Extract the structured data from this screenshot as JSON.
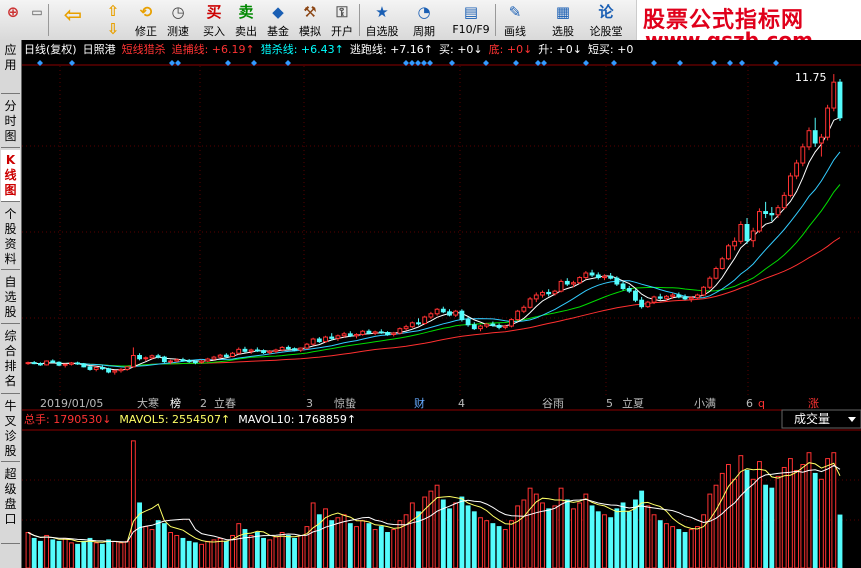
{
  "toolbar": {
    "buttons": [
      {
        "label": "修正",
        "icon": "⟲",
        "name": "revise-button"
      },
      {
        "label": "测速",
        "icon": "◷",
        "name": "speedtest-button"
      },
      {
        "label": "买入",
        "icon": "买",
        "name": "buy-button"
      },
      {
        "label": "卖出",
        "icon": "卖",
        "name": "sell-button"
      },
      {
        "label": "基金",
        "icon": "◆",
        "name": "fund-button"
      },
      {
        "label": "模拟",
        "icon": "⚒",
        "name": "simulate-button"
      },
      {
        "label": "开户",
        "icon": "⚿",
        "name": "open-account-button"
      },
      {
        "label": "自选股",
        "icon": "★",
        "name": "watchlist-button"
      },
      {
        "label": "周期",
        "icon": "◔",
        "name": "period-button"
      },
      {
        "label": "F10/F9",
        "icon": "▤",
        "name": "f10-button"
      },
      {
        "label": "画线",
        "icon": "✎",
        "name": "draw-line-button"
      },
      {
        "label": "选股",
        "icon": "▦",
        "name": "stock-pick-button"
      },
      {
        "label": "论股堂",
        "icon": "论",
        "name": "forum-button"
      }
    ]
  },
  "watermark": {
    "line1": "股票公式指标网",
    "line2": "www.gszb.com"
  },
  "sidebar": {
    "tabs": [
      {
        "label": "应用",
        "active": false
      },
      {
        "label": "分时图",
        "active": false
      },
      {
        "label": "K线图",
        "active": true
      },
      {
        "label": "个股资料",
        "active": false
      },
      {
        "label": "自选股",
        "active": false
      },
      {
        "label": "综合排名",
        "active": false
      },
      {
        "label": "牛叉诊股",
        "active": false
      },
      {
        "label": "超级盘口",
        "active": false
      }
    ]
  },
  "indicator_bar": {
    "items": [
      {
        "text": "日线(复权)",
        "color": "#ffffff"
      },
      {
        "text": "日照港",
        "color": "#ffffff"
      },
      {
        "text": "短线猎杀",
        "color": "#ff3333"
      },
      {
        "text": "追捕线: +6.19↑",
        "color": "#ff3333"
      },
      {
        "text": "猎杀线: +6.43↑",
        "color": "#00ffff"
      },
      {
        "text": "逃跑线: +7.16↑",
        "color": "#ffffff"
      },
      {
        "text": "买: +0↓",
        "color": "#ffffff"
      },
      {
        "text": "底: +0↓",
        "color": "#ff3333"
      },
      {
        "text": "升: +0↓",
        "color": "#ffffff"
      },
      {
        "text": "短买: +0",
        "color": "#ffffff"
      }
    ]
  },
  "price_label": "11.75",
  "axis_labels": [
    {
      "text": "2019/01/05",
      "color": "#bbbbbb"
    },
    {
      "text": "大寒",
      "color": "#bbbbbb"
    },
    {
      "text": "榜",
      "color": "#ffffff"
    },
    {
      "text": "2",
      "color": "#bbbbbb"
    },
    {
      "text": "立春",
      "color": "#bbbbbb"
    },
    {
      "text": "3",
      "color": "#bbbbbb"
    },
    {
      "text": "惊蛰",
      "color": "#bbbbbb"
    },
    {
      "text": "财",
      "color": "#66aaff"
    },
    {
      "text": "4",
      "color": "#bbbbbb"
    },
    {
      "text": "谷雨",
      "color": "#bbbbbb"
    },
    {
      "text": "5",
      "color": "#bbbbbb"
    },
    {
      "text": "立夏",
      "color": "#bbbbbb"
    },
    {
      "text": "小满",
      "color": "#bbbbbb"
    },
    {
      "text": "6",
      "color": "#bbbbbb"
    },
    {
      "text": "q",
      "color": "#ff3333"
    },
    {
      "text": "涨",
      "color": "#ff3333"
    }
  ],
  "volume_bar": {
    "total": "总手: 1790530↓",
    "ma5": "MAVOL5: 2554507↑",
    "ma10": "MAVOL10: 1768859↑",
    "dropdown": "成交量",
    "colors": {
      "total": "#ff3333",
      "ma5": "#ffff66",
      "ma10": "#ffffff"
    }
  },
  "chart_data": {
    "type": "candlestick",
    "symbol": "日照港",
    "period": "日线(复权)",
    "price_ylim": [
      2.2,
      12.0
    ],
    "latest_price_label": 11.75,
    "candles": [
      [
        2.8,
        2.86,
        2.76,
        2.83
      ],
      [
        2.83,
        2.88,
        2.78,
        2.8
      ],
      [
        2.8,
        2.84,
        2.73,
        2.76
      ],
      [
        2.76,
        2.9,
        2.74,
        2.88
      ],
      [
        2.88,
        2.93,
        2.82,
        2.84
      ],
      [
        2.84,
        2.87,
        2.72,
        2.75
      ],
      [
        2.75,
        2.8,
        2.68,
        2.78
      ],
      [
        2.78,
        2.85,
        2.74,
        2.82
      ],
      [
        2.82,
        2.86,
        2.76,
        2.79
      ],
      [
        2.79,
        2.82,
        2.68,
        2.7
      ],
      [
        2.7,
        2.74,
        2.58,
        2.62
      ],
      [
        2.62,
        2.7,
        2.56,
        2.68
      ],
      [
        2.68,
        2.74,
        2.6,
        2.64
      ],
      [
        2.64,
        2.67,
        2.5,
        2.54
      ],
      [
        2.54,
        2.6,
        2.46,
        2.58
      ],
      [
        2.58,
        2.66,
        2.52,
        2.62
      ],
      [
        2.62,
        2.72,
        2.58,
        2.7
      ],
      [
        2.7,
        3.3,
        2.68,
        3.05
      ],
      [
        3.05,
        3.12,
        2.9,
        2.95
      ],
      [
        2.95,
        3.02,
        2.88,
        2.98
      ],
      [
        2.98,
        3.08,
        2.94,
        3.04
      ],
      [
        3.04,
        3.1,
        2.96,
        3.0
      ],
      [
        3.0,
        3.04,
        2.82,
        2.86
      ],
      [
        2.86,
        2.92,
        2.78,
        2.88
      ],
      [
        2.88,
        2.96,
        2.84,
        2.92
      ],
      [
        2.92,
        2.98,
        2.86,
        2.9
      ],
      [
        2.9,
        2.94,
        2.82,
        2.86
      ],
      [
        2.86,
        2.9,
        2.78,
        2.84
      ],
      [
        2.84,
        2.92,
        2.8,
        2.88
      ],
      [
        2.88,
        2.98,
        2.84,
        2.94
      ],
      [
        2.94,
        3.04,
        2.9,
        3.0
      ],
      [
        3.0,
        3.1,
        2.96,
        3.06
      ],
      [
        3.06,
        3.12,
        2.98,
        3.02
      ],
      [
        3.02,
        3.16,
        3.0,
        3.12
      ],
      [
        3.12,
        3.3,
        3.08,
        3.24
      ],
      [
        3.24,
        3.32,
        3.14,
        3.18
      ],
      [
        3.18,
        3.26,
        3.1,
        3.22
      ],
      [
        3.22,
        3.3,
        3.16,
        3.2
      ],
      [
        3.2,
        3.24,
        3.1,
        3.14
      ],
      [
        3.14,
        3.22,
        3.08,
        3.18
      ],
      [
        3.18,
        3.26,
        3.12,
        3.22
      ],
      [
        3.22,
        3.34,
        3.18,
        3.3
      ],
      [
        3.3,
        3.36,
        3.22,
        3.26
      ],
      [
        3.26,
        3.3,
        3.18,
        3.22
      ],
      [
        3.22,
        3.3,
        3.16,
        3.28
      ],
      [
        3.28,
        3.44,
        3.24,
        3.4
      ],
      [
        3.4,
        3.6,
        3.36,
        3.56
      ],
      [
        3.56,
        3.62,
        3.44,
        3.48
      ],
      [
        3.48,
        3.66,
        3.44,
        3.62
      ],
      [
        3.62,
        3.74,
        3.52,
        3.58
      ],
      [
        3.58,
        3.7,
        3.5,
        3.66
      ],
      [
        3.66,
        3.78,
        3.6,
        3.72
      ],
      [
        3.72,
        3.8,
        3.62,
        3.66
      ],
      [
        3.66,
        3.74,
        3.58,
        3.7
      ],
      [
        3.7,
        3.84,
        3.66,
        3.8
      ],
      [
        3.8,
        3.86,
        3.7,
        3.74
      ],
      [
        3.74,
        3.82,
        3.68,
        3.78
      ],
      [
        3.78,
        3.86,
        3.72,
        3.76
      ],
      [
        3.76,
        3.8,
        3.66,
        3.7
      ],
      [
        3.7,
        3.78,
        3.64,
        3.74
      ],
      [
        3.74,
        3.92,
        3.7,
        3.88
      ],
      [
        3.88,
        4.0,
        3.82,
        3.94
      ],
      [
        3.94,
        4.1,
        3.9,
        4.06
      ],
      [
        4.06,
        4.2,
        3.98,
        4.04
      ],
      [
        4.04,
        4.28,
        4.0,
        4.24
      ],
      [
        4.24,
        4.4,
        4.18,
        4.34
      ],
      [
        4.34,
        4.52,
        4.28,
        4.48
      ],
      [
        4.48,
        4.56,
        4.36,
        4.4
      ],
      [
        4.4,
        4.48,
        4.26,
        4.3
      ],
      [
        4.3,
        4.46,
        4.24,
        4.42
      ],
      [
        4.42,
        4.48,
        4.1,
        4.16
      ],
      [
        4.16,
        4.24,
        3.94,
        4.0
      ],
      [
        4.0,
        4.08,
        3.84,
        3.88
      ],
      [
        3.88,
        4.0,
        3.8,
        3.96
      ],
      [
        3.96,
        4.06,
        3.9,
        4.02
      ],
      [
        4.02,
        4.1,
        3.94,
        3.98
      ],
      [
        3.98,
        4.04,
        3.86,
        3.92
      ],
      [
        3.92,
        4.0,
        3.86,
        3.96
      ],
      [
        3.96,
        4.2,
        3.92,
        4.16
      ],
      [
        4.16,
        4.46,
        4.12,
        4.42
      ],
      [
        4.42,
        4.6,
        4.36,
        4.54
      ],
      [
        4.54,
        4.86,
        4.5,
        4.8
      ],
      [
        4.8,
        5.0,
        4.7,
        4.92
      ],
      [
        4.92,
        5.06,
        4.84,
        5.0
      ],
      [
        5.0,
        5.1,
        4.88,
        4.96
      ],
      [
        4.96,
        5.08,
        4.9,
        5.04
      ],
      [
        5.04,
        5.4,
        5.0,
        5.34
      ],
      [
        5.34,
        5.44,
        5.2,
        5.26
      ],
      [
        5.26,
        5.36,
        5.16,
        5.3
      ],
      [
        5.3,
        5.5,
        5.26,
        5.46
      ],
      [
        5.46,
        5.66,
        5.4,
        5.6
      ],
      [
        5.6,
        5.7,
        5.48,
        5.54
      ],
      [
        5.54,
        5.62,
        5.4,
        5.46
      ],
      [
        5.46,
        5.56,
        5.38,
        5.5
      ],
      [
        5.5,
        5.6,
        5.4,
        5.44
      ],
      [
        5.44,
        5.5,
        5.2,
        5.26
      ],
      [
        5.26,
        5.34,
        5.06,
        5.12
      ],
      [
        5.12,
        5.2,
        4.98,
        5.04
      ],
      [
        5.04,
        5.1,
        4.7,
        4.76
      ],
      [
        4.76,
        4.86,
        4.5,
        4.56
      ],
      [
        4.56,
        4.74,
        4.52,
        4.7
      ],
      [
        4.7,
        4.9,
        4.64,
        4.86
      ],
      [
        4.86,
        4.96,
        4.76,
        4.82
      ],
      [
        4.82,
        4.92,
        4.72,
        4.88
      ],
      [
        4.88,
        4.98,
        4.8,
        4.92
      ],
      [
        4.92,
        5.0,
        4.82,
        4.86
      ],
      [
        4.86,
        4.94,
        4.76,
        4.8
      ],
      [
        4.8,
        4.88,
        4.7,
        4.84
      ],
      [
        4.84,
        4.96,
        4.8,
        4.92
      ],
      [
        4.92,
        5.2,
        4.88,
        5.16
      ],
      [
        5.16,
        5.5,
        5.1,
        5.44
      ],
      [
        5.44,
        5.8,
        5.4,
        5.74
      ],
      [
        5.74,
        6.1,
        5.7,
        6.04
      ],
      [
        6.04,
        6.5,
        6.0,
        6.44
      ],
      [
        6.44,
        6.7,
        6.3,
        6.58
      ],
      [
        6.58,
        7.2,
        6.5,
        7.1
      ],
      [
        7.1,
        7.3,
        6.5,
        6.6
      ],
      [
        6.6,
        7.0,
        6.4,
        6.9
      ],
      [
        6.9,
        7.6,
        6.84,
        7.5
      ],
      [
        7.5,
        7.8,
        7.3,
        7.44
      ],
      [
        7.44,
        7.64,
        7.2,
        7.4
      ],
      [
        7.4,
        7.7,
        7.3,
        7.62
      ],
      [
        7.62,
        8.1,
        7.56,
        8.0
      ],
      [
        8.0,
        8.7,
        7.94,
        8.6
      ],
      [
        8.6,
        9.1,
        8.5,
        9.0
      ],
      [
        9.0,
        9.6,
        8.9,
        9.5
      ],
      [
        9.5,
        10.1,
        9.4,
        10.0
      ],
      [
        10.0,
        10.4,
        9.5,
        9.62
      ],
      [
        9.62,
        9.9,
        9.2,
        9.8
      ],
      [
        9.8,
        10.8,
        9.7,
        10.7
      ],
      [
        10.7,
        11.75,
        10.6,
        11.5
      ],
      [
        11.5,
        11.6,
        10.3,
        10.4
      ]
    ],
    "volume_ylim": [
      0,
      4600000
    ],
    "volumes": [
      1200000,
      1000000,
      900000,
      1100000,
      950000,
      900000,
      1000000,
      850000,
      800000,
      900000,
      1000000,
      850000,
      800000,
      950000,
      900000,
      850000,
      900000,
      4300000,
      2200000,
      1400000,
      1300000,
      1600000,
      1500000,
      1200000,
      1100000,
      1000000,
      900000,
      850000,
      800000,
      900000,
      950000,
      1000000,
      900000,
      1100000,
      1500000,
      1300000,
      1100000,
      1200000,
      1000000,
      950000,
      1050000,
      1200000,
      1100000,
      1000000,
      1100000,
      1400000,
      2200000,
      1800000,
      2000000,
      1600000,
      1700000,
      1800000,
      1500000,
      1400000,
      1600000,
      1500000,
      1300000,
      1400000,
      1200000,
      1300000,
      1600000,
      1800000,
      2200000,
      1900000,
      2400000,
      2600000,
      2800000,
      2300000,
      2000000,
      2200000,
      2400000,
      2100000,
      1900000,
      1700000,
      1600000,
      1500000,
      1400000,
      1300000,
      1600000,
      2100000,
      2300000,
      2700000,
      2500000,
      2200000,
      2000000,
      2100000,
      2700000,
      2300000,
      2000000,
      2200000,
      2500000,
      2100000,
      1900000,
      1800000,
      1700000,
      2000000,
      2200000,
      1900000,
      2300000,
      2600000,
      2100000,
      1800000,
      1600000,
      1500000,
      1400000,
      1300000,
      1200000,
      1300000,
      1400000,
      1800000,
      2500000,
      2800000,
      3200000,
      3500000,
      3000000,
      3800000,
      3300000,
      3000000,
      3600000,
      2800000,
      2700000,
      3100000,
      3400000,
      3700000,
      3300000,
      3500000,
      3900000,
      3200000,
      3000000,
      3700000,
      3900000,
      1790530
    ],
    "volume_ma5_latest": 2554507,
    "volume_ma10_latest": 1768859
  }
}
